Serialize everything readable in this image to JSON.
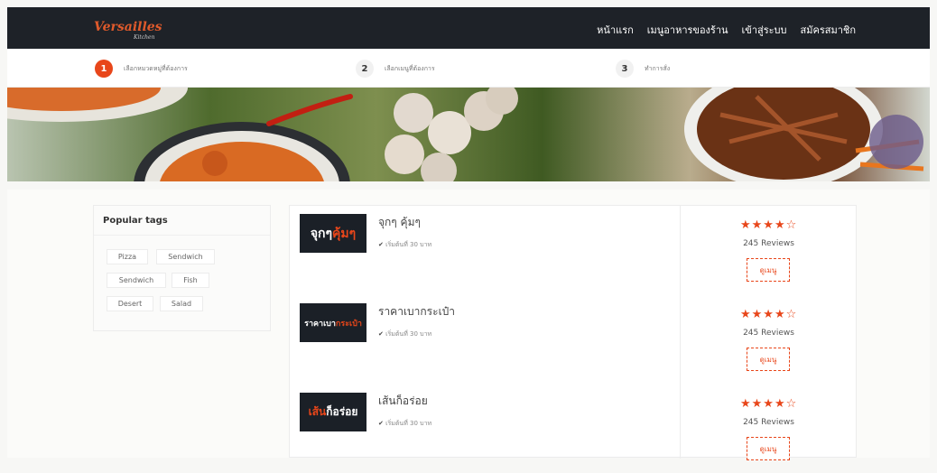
{
  "header": {
    "logo": "Versailles",
    "logo_sub": "Kitchen",
    "nav": [
      "หน้าแรก",
      "เมนูอาหารของร้าน",
      "เข้าสู่ระบบ",
      "สมัครสมาชิก"
    ]
  },
  "steps": [
    {
      "num": "1",
      "label": "เลือกหมวดหมู่ที่ต้องการ",
      "active": true
    },
    {
      "num": "2",
      "label": "เลือกเมนูที่ต้องการ",
      "active": false
    },
    {
      "num": "3",
      "label": "ทำการสั่ง",
      "active": false
    }
  ],
  "sidebar": {
    "title": "Popular tags",
    "tags": [
      "Pizza",
      "Sendwich",
      "Sendwich",
      "Fish",
      "Desert",
      "Salad"
    ]
  },
  "shops": [
    {
      "name": "จุกๆ คุ้มๆ",
      "logo_white": "จุกๆ",
      "logo_orange": "คุ้มๆ",
      "price": "เริ่มต้นที่ 30 บาท",
      "rating": 4,
      "reviews": "245 Reviews",
      "menu_label": "ดูเมนู"
    },
    {
      "name": "ราคาเบากระเป๋า",
      "logo_white": "ราคาเบา",
      "logo_orange": "กระเป๋า",
      "price": "เริ่มต้นที่ 30 บาท",
      "rating": 4,
      "reviews": "245 Reviews",
      "menu_label": "ดูเมนู"
    },
    {
      "name": "เส้นก็อร่อย",
      "logo_orange": "เส้น",
      "logo_white": "ก็อร่อย",
      "price": "เริ่มต้นที่ 30 บาท",
      "rating": 4,
      "reviews": "245 Reviews",
      "menu_label": "ดูเมนู"
    }
  ],
  "colors": {
    "accent": "#e8461a",
    "header_bg": "#1e2228"
  }
}
